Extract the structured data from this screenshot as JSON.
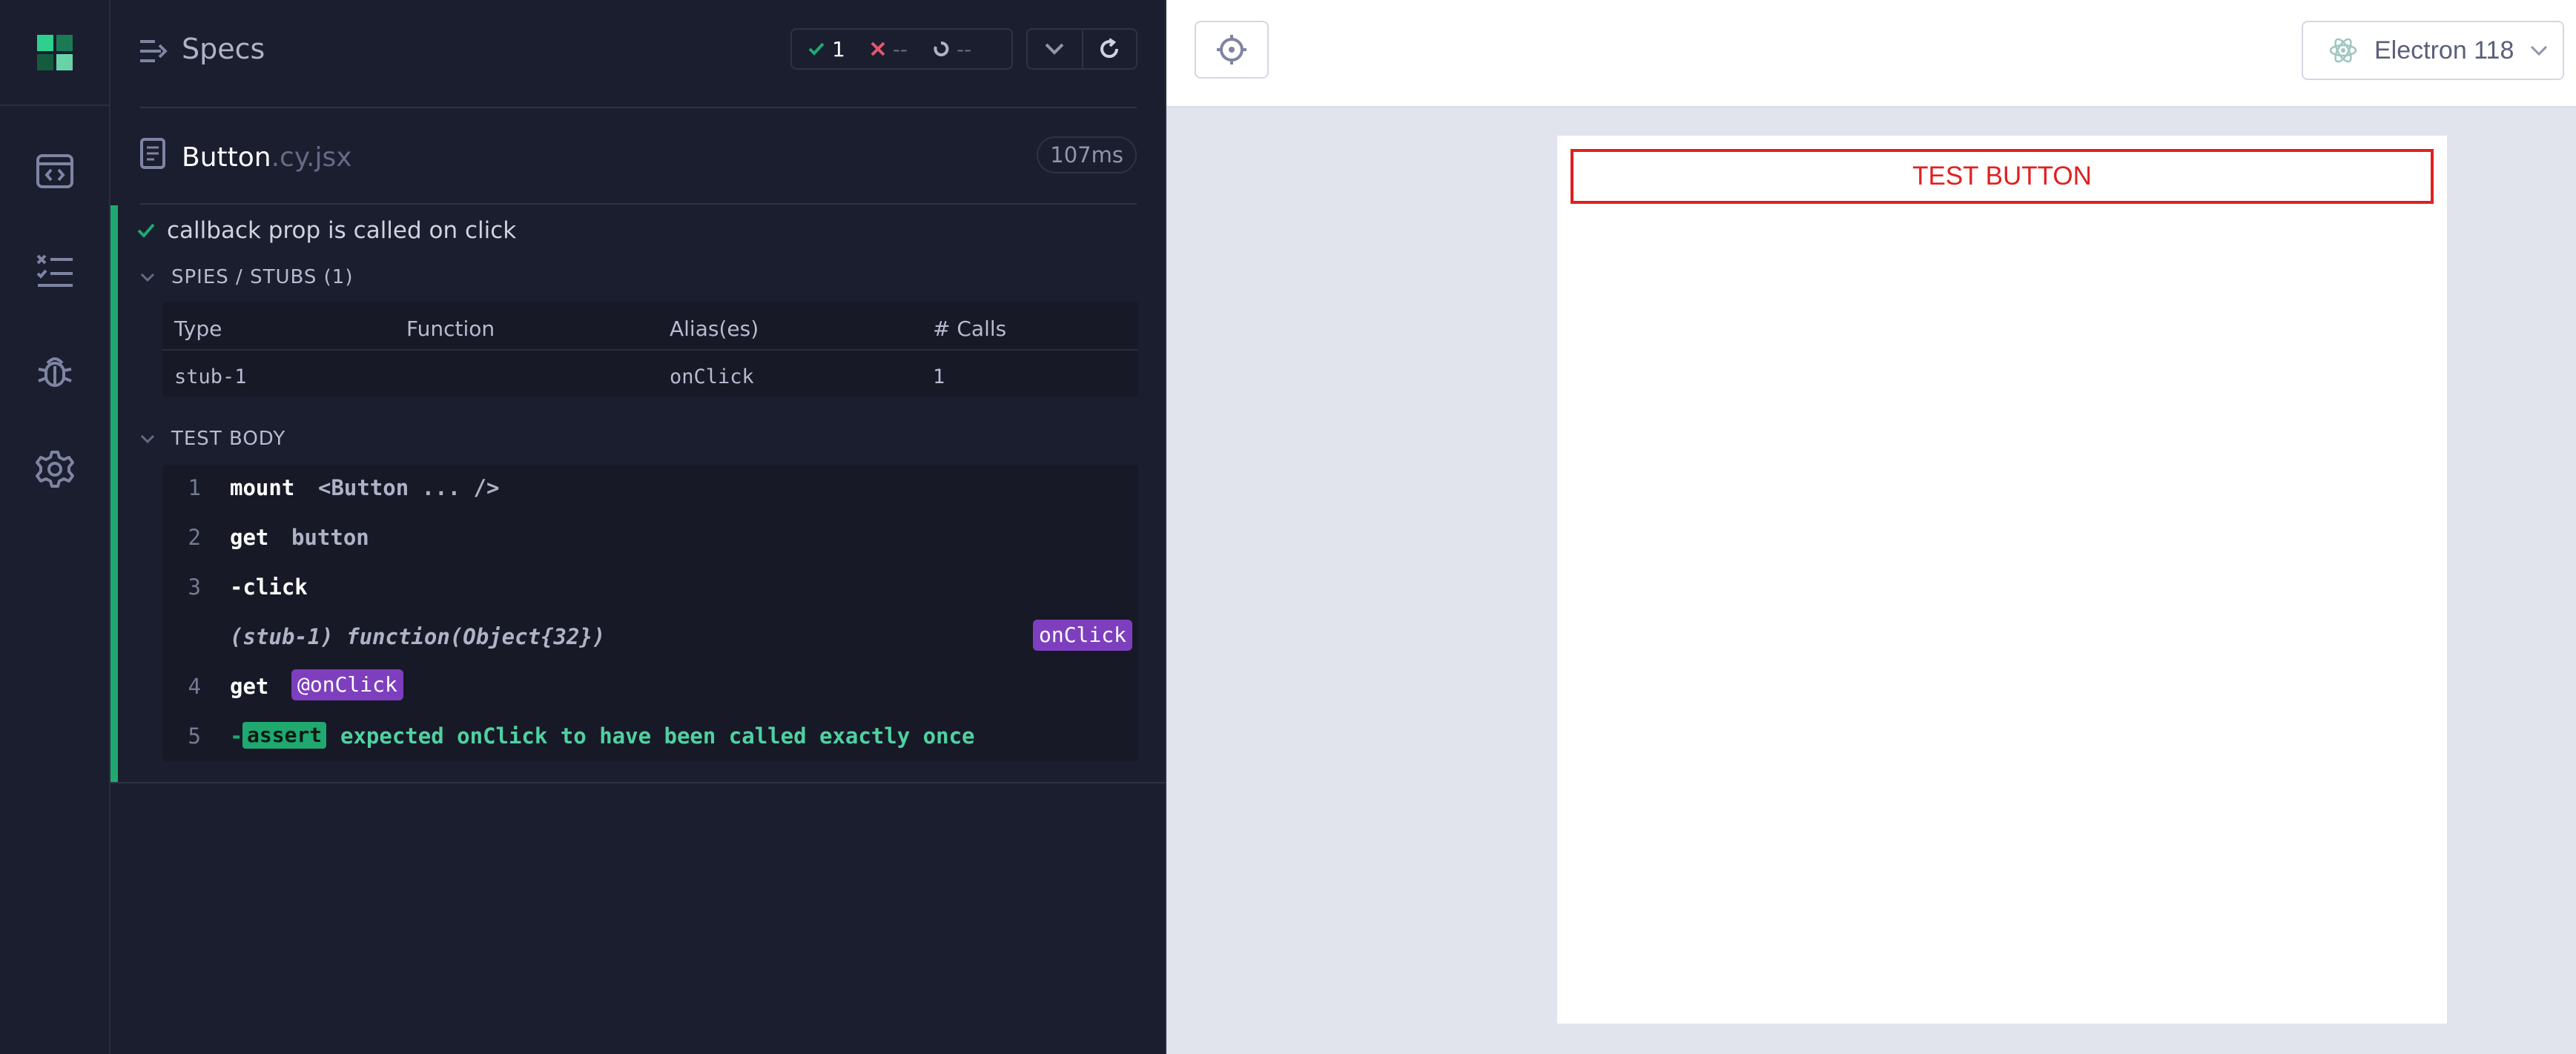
{
  "nav": {
    "items": [
      {
        "name": "runs-icon"
      },
      {
        "name": "specs-list-icon"
      },
      {
        "name": "debug-icon"
      },
      {
        "name": "settings-icon"
      }
    ]
  },
  "reporter": {
    "specs_label": "Specs",
    "stats": {
      "passed": "1",
      "failed": "--",
      "pending": "--"
    },
    "spec": {
      "name": "Button",
      "ext": ".cy.jsx",
      "duration": "107ms"
    },
    "test": {
      "title": "callback prop is called on click",
      "spies_header": "SPIES / STUBS (1)",
      "spies_columns": [
        "Type",
        "Function",
        "Alias(es)",
        "# Calls"
      ],
      "spies_rows": [
        {
          "type": "stub-1",
          "function": "",
          "alias": "onClick",
          "calls": "1"
        }
      ],
      "body_header": "TEST BODY",
      "commands": [
        {
          "num": "1",
          "name": "mount",
          "message": "<Button ... />"
        },
        {
          "num": "2",
          "name": "get",
          "message": "button"
        },
        {
          "num": "3",
          "name": "-click",
          "message": ""
        },
        {
          "num": "",
          "name": "",
          "message": "(stub-1)  function(Object{32})",
          "alias": "onClick"
        },
        {
          "num": "4",
          "name": "get",
          "message": "",
          "alias": "@onClick"
        },
        {
          "num": "5",
          "name": "-",
          "badge": "assert",
          "message": "expected onClick to have been called exactly once"
        }
      ]
    }
  },
  "aut": {
    "browser": "Electron 118",
    "test_button_label": "TEST BUTTON"
  },
  "colors": {
    "pass": "#1fa971",
    "fail": "#e45770",
    "alias": "#7e3fbf",
    "aut_button": "#e02020"
  }
}
